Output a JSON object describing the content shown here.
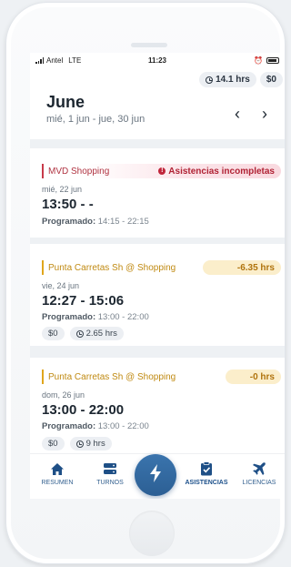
{
  "status_bar": {
    "carrier": "Antel",
    "network": "LTE",
    "time": "11:23"
  },
  "header": {
    "hours_pill": "14.1 hrs",
    "money_pill": "$0",
    "month": "June",
    "date_range": "mié, 1 jun - jue, 30 jun",
    "prev_icon": "chevron-left-icon",
    "next_icon": "chevron-right-icon"
  },
  "shifts": [
    {
      "location": "MVD Shopping",
      "status": "Asistencias incompletas",
      "status_color": "#b02234",
      "date": "mié, 22 jun",
      "time": "13:50 - -",
      "scheduled_label": "Programado:",
      "scheduled": "14:15 - 22:15"
    },
    {
      "location": "Punta Carretas Sh @ Shopping",
      "status": "-6.35 hrs",
      "status_color": "#b0730d",
      "date": "vie, 24 jun",
      "time": "12:27 - 15:06",
      "scheduled_label": "Programado:",
      "scheduled": "13:00 - 22:00",
      "money": "$0",
      "hours": "2.65 hrs"
    },
    {
      "location": "Punta Carretas Sh @ Shopping",
      "status": "-0 hrs",
      "status_color": "#b0730d",
      "date": "dom, 26 jun",
      "time": "13:00 - 22:00",
      "scheduled_label": "Programado:",
      "scheduled": "13:00 - 22:00",
      "money": "$0",
      "hours": "9 hrs"
    }
  ],
  "tabs": [
    {
      "label": "RESUMEN",
      "icon": "home-icon"
    },
    {
      "label": "TURNOS",
      "icon": "server-icon"
    },
    {
      "label": "ASISTENCIAS",
      "icon": "clipboard-check-icon",
      "active": true
    },
    {
      "label": "LICENCIAS",
      "icon": "airplane-icon"
    }
  ],
  "fab_icon": "lightning-icon",
  "colors": {
    "accent": "#2c5f94",
    "tab_text": "#33608f",
    "red": "#c83a4a",
    "amber": "#e0a61c"
  }
}
